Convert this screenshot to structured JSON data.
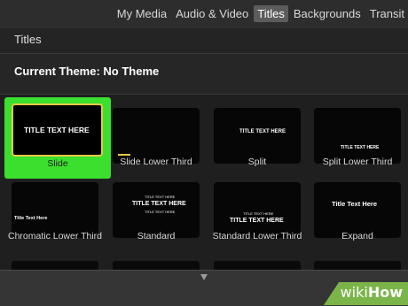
{
  "tabs": [
    "My Media",
    "Audio & Video",
    "Titles",
    "Backgrounds",
    "Transit"
  ],
  "active_tab": "Titles",
  "section_title": "Titles",
  "current_theme": "Current Theme: No Theme",
  "tiles": [
    {
      "caption": "Slide",
      "thumb_text": "TITLE TEXT HERE",
      "selected": true
    },
    {
      "caption": "Slide Lower Third",
      "thumb_text": ""
    },
    {
      "caption": "Split",
      "thumb_text": "TITLE TEXT HERE"
    },
    {
      "caption": "Split Lower Third",
      "thumb_text": "TITLE TEXT HERE"
    },
    {
      "caption": "Chromatic Lower Third",
      "thumb_text": "Title Text Here"
    },
    {
      "caption": "Standard",
      "thumb_text_top": "TITLE TEXT HERE",
      "thumb_text": "TITLE TEXT HERE",
      "thumb_text_bottom": "TITLE TEXT HERE"
    },
    {
      "caption": "Standard Lower Third",
      "thumb_text_top": "TITLE TEXT HERE",
      "thumb_text": "TITLE TEXT HERE"
    },
    {
      "caption": "Expand",
      "thumb_text": "Title Text Here"
    }
  ],
  "watermark": {
    "prefix": "wiki",
    "suffix": "How"
  },
  "colors": {
    "selection_green": "#3be02f",
    "selection_gold": "#e8c843",
    "watermark_green": "#7bb54a"
  }
}
